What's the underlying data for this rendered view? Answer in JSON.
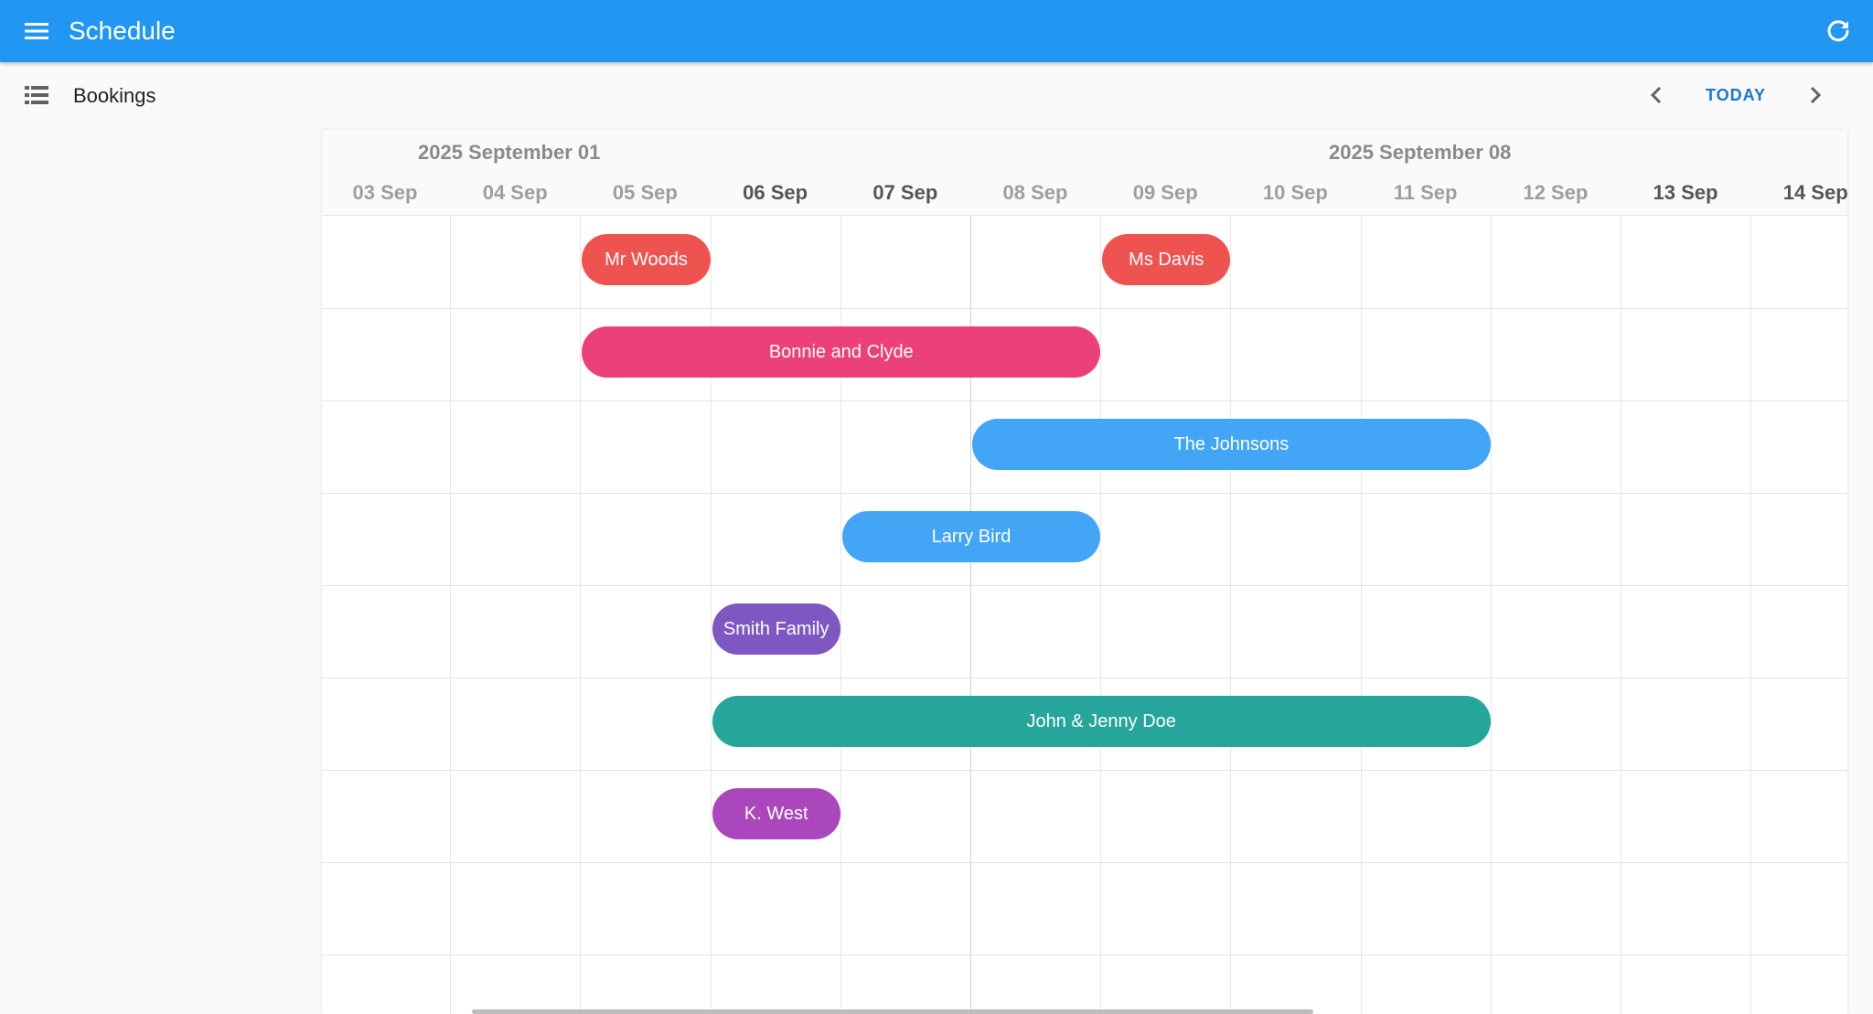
{
  "appbar": {
    "title": "Schedule",
    "color": "#2196f3",
    "menu_icon": "menu-icon",
    "refresh_icon": "refresh-icon"
  },
  "toolbar": {
    "view_icon": "list-icon",
    "label": "Bookings",
    "prev_icon": "chevron-left-icon",
    "today_label": "TODAY",
    "next_icon": "chevron-right-icon"
  },
  "timeline": {
    "weeks": [
      {
        "label": "2025 September 01"
      },
      {
        "label": "2025 September 08"
      }
    ],
    "days": [
      {
        "label": "03 Sep",
        "weekend": false
      },
      {
        "label": "04 Sep",
        "weekend": false
      },
      {
        "label": "05 Sep",
        "weekend": false
      },
      {
        "label": "06 Sep",
        "weekend": true
      },
      {
        "label": "07 Sep",
        "weekend": true
      },
      {
        "label": "08 Sep",
        "weekend": false
      },
      {
        "label": "09 Sep",
        "weekend": false
      },
      {
        "label": "10 Sep",
        "weekend": false
      },
      {
        "label": "11 Sep",
        "weekend": false
      },
      {
        "label": "12 Sep",
        "weekend": false
      },
      {
        "label": "13 Sep",
        "weekend": true
      },
      {
        "label": "14 Sep",
        "weekend": true
      }
    ],
    "bookings": [
      {
        "name": "Mr Woods",
        "row": 0,
        "start": "05 Sep",
        "end": "06 Sep",
        "color": "#ef5350"
      },
      {
        "name": "Ms Davis",
        "row": 0,
        "start": "09 Sep",
        "end": "10 Sep",
        "color": "#ef5350"
      },
      {
        "name": "Bonnie and Clyde",
        "row": 1,
        "start": "05 Sep",
        "end": "09 Sep",
        "color": "#ec407a"
      },
      {
        "name": "The Johnsons",
        "row": 2,
        "start": "08 Sep",
        "end": "12 Sep",
        "color": "#42a5f5"
      },
      {
        "name": "Larry Bird",
        "row": 3,
        "start": "07 Sep",
        "end": "09 Sep",
        "color": "#42a5f5"
      },
      {
        "name": "Smith Family",
        "row": 4,
        "start": "06 Sep",
        "end": "07 Sep",
        "color": "#7e57c2"
      },
      {
        "name": "John & Jenny Doe",
        "row": 5,
        "start": "06 Sep",
        "end": "12 Sep",
        "color": "#26a69a"
      },
      {
        "name": "K. West",
        "row": 6,
        "start": "06 Sep",
        "end": "07 Sep",
        "color": "#ab47bc"
      }
    ]
  }
}
